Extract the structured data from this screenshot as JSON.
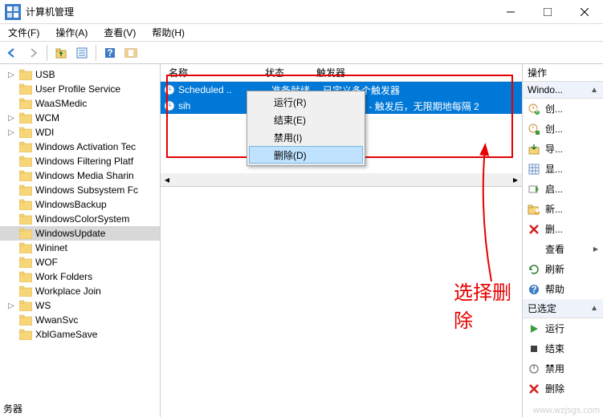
{
  "window": {
    "title": "计算机管理"
  },
  "menu": {
    "file": "文件(F)",
    "action": "操作(A)",
    "view": "查看(V)",
    "help": "帮助(H)"
  },
  "tree": {
    "items": [
      {
        "label": "USB",
        "exp": "▷"
      },
      {
        "label": "User Profile Service",
        "exp": ""
      },
      {
        "label": "WaaSMedic",
        "exp": ""
      },
      {
        "label": "WCM",
        "exp": "▷"
      },
      {
        "label": "WDI",
        "exp": "▷"
      },
      {
        "label": "Windows Activation Tec",
        "exp": ""
      },
      {
        "label": "Windows Filtering Platf",
        "exp": ""
      },
      {
        "label": "Windows Media Sharin",
        "exp": ""
      },
      {
        "label": "Windows Subsystem Fc",
        "exp": ""
      },
      {
        "label": "WindowsBackup",
        "exp": ""
      },
      {
        "label": "WindowsColorSystem",
        "exp": ""
      },
      {
        "label": "WindowsUpdate",
        "exp": "",
        "selected": true
      },
      {
        "label": "Wininet",
        "exp": ""
      },
      {
        "label": "WOF",
        "exp": ""
      },
      {
        "label": "Work Folders",
        "exp": ""
      },
      {
        "label": "Workplace Join",
        "exp": ""
      },
      {
        "label": "WS",
        "exp": "▷"
      },
      {
        "label": "WwanSvc",
        "exp": ""
      },
      {
        "label": "XblGameSave",
        "exp": ""
      }
    ],
    "status": "务器"
  },
  "columns": {
    "name": "名称",
    "status": "状态",
    "trigger": "触发器"
  },
  "tasks": [
    {
      "name": "Scheduled ..",
      "status": "准备就绪",
      "trigger": "已定义多个触发器"
    },
    {
      "name": "sih",
      "status": "",
      "trigger": "的 8:00 时 - 触发后，无限期地每隔 2"
    }
  ],
  "context_menu": {
    "run": "运行(R)",
    "end": "结束(E)",
    "disable": "禁用(I)",
    "delete": "删除(D)"
  },
  "annotation": {
    "text": "选择删除"
  },
  "actions": {
    "title": "操作",
    "section1": {
      "header": "Windo...",
      "items": [
        {
          "label": "创...",
          "icon": "clock-new"
        },
        {
          "label": "创...",
          "icon": "clock-new2"
        },
        {
          "label": "导...",
          "icon": "import"
        },
        {
          "label": "显...",
          "icon": "grid"
        },
        {
          "label": "启...",
          "icon": "play-green"
        },
        {
          "label": "新...",
          "icon": "folder-new"
        },
        {
          "label": "删...",
          "icon": "delete-x"
        },
        {
          "label": "查看",
          "icon": "",
          "arrow": true
        },
        {
          "label": "刷新",
          "icon": "refresh"
        },
        {
          "label": "帮助",
          "icon": "help"
        }
      ]
    },
    "section2": {
      "header": "已选定",
      "items": [
        {
          "label": "运行",
          "icon": "play"
        },
        {
          "label": "结束",
          "icon": "stop"
        },
        {
          "label": "禁用",
          "icon": "disable"
        },
        {
          "label": "删除",
          "icon": "delete-x"
        }
      ]
    }
  },
  "watermark": "www.wzjsgs.com"
}
